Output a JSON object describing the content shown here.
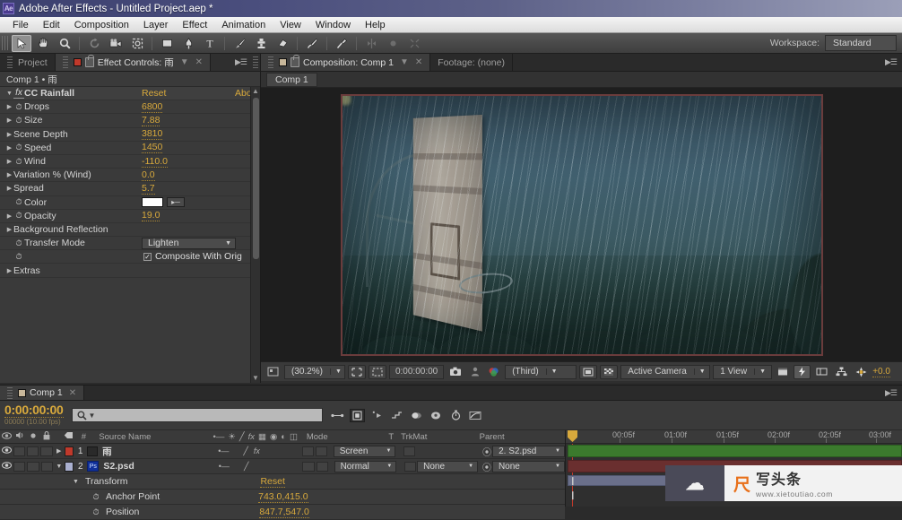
{
  "window": {
    "app_icon": "Ae",
    "title": "Adobe After Effects - Untitled Project.aep *"
  },
  "menubar": {
    "items": [
      "File",
      "Edit",
      "Composition",
      "Layer",
      "Effect",
      "Animation",
      "View",
      "Window",
      "Help"
    ]
  },
  "toolbar": {
    "tools": [
      {
        "name": "selection-tool",
        "glyph": "➤",
        "selected": true
      },
      {
        "name": "hand-tool",
        "glyph": "✋",
        "selected": false
      },
      {
        "name": "zoom-tool",
        "glyph": "🔍",
        "selected": false
      },
      {
        "name": "rotation-tool",
        "glyph": "↻",
        "selected": false
      },
      {
        "name": "camera-tool",
        "glyph": "🎥",
        "selected": false
      },
      {
        "name": "pan-behind-tool",
        "glyph": "✣",
        "selected": false
      },
      {
        "name": "shape-tool",
        "glyph": "■",
        "selected": false
      },
      {
        "name": "pen-tool",
        "glyph": "✒",
        "selected": false
      },
      {
        "name": "type-tool",
        "glyph": "T",
        "selected": false
      },
      {
        "name": "brush-tool",
        "glyph": "╱",
        "selected": false
      },
      {
        "name": "clone-stamp-tool",
        "glyph": "⚘",
        "selected": false
      },
      {
        "name": "eraser-tool",
        "glyph": "▰",
        "selected": false
      },
      {
        "name": "roto-brush-tool",
        "glyph": "✒",
        "selected": false
      },
      {
        "name": "puppet-pin-tool",
        "glyph": "✐",
        "selected": false
      }
    ],
    "workspace_label": "Workspace:",
    "workspace_value": "Standard"
  },
  "effect_controls": {
    "tab_project": "Project",
    "tab_effect": "Effect Controls: 雨",
    "subheader": "Comp 1 • 雨",
    "effect_name": "CC Rainfall",
    "reset_label": "Reset",
    "about_label": "Abou",
    "properties": [
      {
        "name": "Drops",
        "value": "6800",
        "type": "value",
        "arrow": true,
        "stopwatch": true
      },
      {
        "name": "Size",
        "value": "7.88",
        "type": "value",
        "arrow": true,
        "stopwatch": true
      },
      {
        "name": "Scene Depth",
        "value": "3810",
        "type": "value",
        "arrow": true,
        "stopwatch": false
      },
      {
        "name": "Speed",
        "value": "1450",
        "type": "value",
        "arrow": true,
        "stopwatch": true
      },
      {
        "name": "Wind",
        "value": "-110.0",
        "type": "value",
        "arrow": true,
        "stopwatch": true
      },
      {
        "name": "Variation % (Wind)",
        "value": "0.0",
        "type": "value",
        "arrow": true,
        "stopwatch": false
      },
      {
        "name": "Spread",
        "value": "5.7",
        "type": "value",
        "arrow": true,
        "stopwatch": false
      },
      {
        "name": "Color",
        "value": "#FFFFFF",
        "type": "color",
        "arrow": false,
        "stopwatch": true
      },
      {
        "name": "Opacity",
        "value": "19.0",
        "type": "value",
        "arrow": true,
        "stopwatch": true
      },
      {
        "name": "Background Reflection",
        "value": "",
        "type": "group",
        "arrow": true,
        "stopwatch": false
      },
      {
        "name": "Transfer Mode",
        "value": "Lighten",
        "type": "dropdown",
        "arrow": false,
        "stopwatch": true
      },
      {
        "name": "",
        "value": "Composite With Orig",
        "type": "checkbox",
        "checked": true,
        "arrow": false,
        "stopwatch": true
      },
      {
        "name": "Extras",
        "value": "",
        "type": "group",
        "arrow": true,
        "stopwatch": false
      }
    ]
  },
  "composition": {
    "tab_composition": "Composition: Comp 1",
    "tab_footage": "Footage: (none)",
    "subtab": "Comp 1",
    "footer": {
      "zoom": "(30.2%)",
      "time": "0:00:00:00",
      "resolution": "(Third)",
      "camera": "Active Camera",
      "views": "1 View",
      "exposure": "+0.0"
    }
  },
  "timeline": {
    "tab": "Comp 1",
    "current_time": "0:00:00:00",
    "frame_info": "00000 (10.00 fps)",
    "search_placeholder": "",
    "columns": [
      "#",
      "Source Name",
      "Mode",
      "T",
      "TrkMat",
      "Parent"
    ],
    "layers": [
      {
        "index": "1",
        "name": "雨",
        "mode": "Screen",
        "trkmat": "",
        "parent": "2. S2.psd",
        "color": "#c0392b",
        "fx": true
      },
      {
        "index": "2",
        "name": "S2.psd",
        "mode": "Normal",
        "trkmat": "None",
        "parent": "None",
        "color": "#aab0d0",
        "fx": false
      }
    ],
    "properties": [
      {
        "name": "Transform",
        "value": "Reset"
      },
      {
        "name": "Anchor Point",
        "value": "743.0,415.0"
      },
      {
        "name": "Position",
        "value": "847.7,547.0"
      }
    ],
    "ruler_ticks": [
      "00:05f",
      "01:00f",
      "01:05f",
      "02:00f",
      "02:05f",
      "03:00f"
    ],
    "ruler_start": "0f"
  },
  "watermark": {
    "title": "写头条",
    "url": "www.xietoutiao.com"
  },
  "colors": {
    "accent_amber": "#d8a93c",
    "panel_bg": "#3a3a3a",
    "title_gradient_start": "#3b3f6e"
  }
}
